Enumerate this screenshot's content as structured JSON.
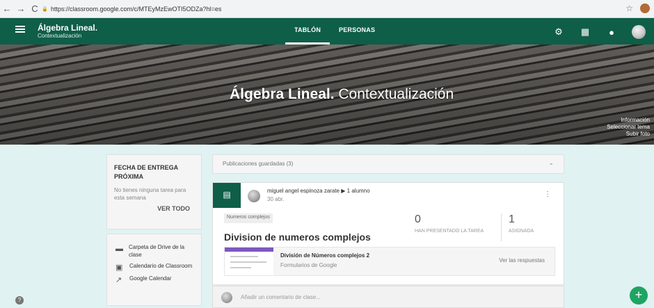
{
  "browser": {
    "url": "https://classroom.google.com/c/MTEyMzEwOTI5ODZa?hl=es"
  },
  "header": {
    "course_title": "Álgebra Lineal.",
    "course_subtitle": "Contextualización",
    "tabs": [
      "TABLÓN",
      "PERSONAS"
    ]
  },
  "banner": {
    "title_bold": "Álgebra Lineal.",
    "title_rest": " Contextualización",
    "menu": [
      "Información",
      "Seleccionar tema",
      "Subir foto"
    ]
  },
  "left": {
    "heading": "FECHA DE ENTREGA PRÓXIMA",
    "subtitle": "No tienes ninguna tarea para esta semana",
    "see_all": "VER TODO",
    "links": [
      "Carpeta de Drive de la clase",
      "Calendario de Classroom",
      "Google Calendar"
    ]
  },
  "saved": {
    "label": "Publicaciones guardadas (3)"
  },
  "post": {
    "author": "miguel angel espinoza zarate ▶ 1 alumno",
    "date": "30 abr.",
    "topic": "Numeros complejos",
    "title": "Division de numeros complejos",
    "stats": [
      {
        "value": "0",
        "label": "HAN PRESENTADO LA TAREA"
      },
      {
        "value": "1",
        "label": "ASIGNADA"
      }
    ],
    "form_title": "División de Números complejos 2",
    "form_subtitle": "Formularios de Google",
    "view_responses": "Ver las respuestas"
  },
  "comment": {
    "placeholder": "Añadir un comentario de clase..."
  },
  "icons": {
    "settings": "gear-icon",
    "apps": "apps-grid-icon",
    "fab": "+",
    "help": "?"
  },
  "colors": {
    "primary": "#0e5e48",
    "accent": "#1fa463",
    "background": "#e0f2f1"
  }
}
